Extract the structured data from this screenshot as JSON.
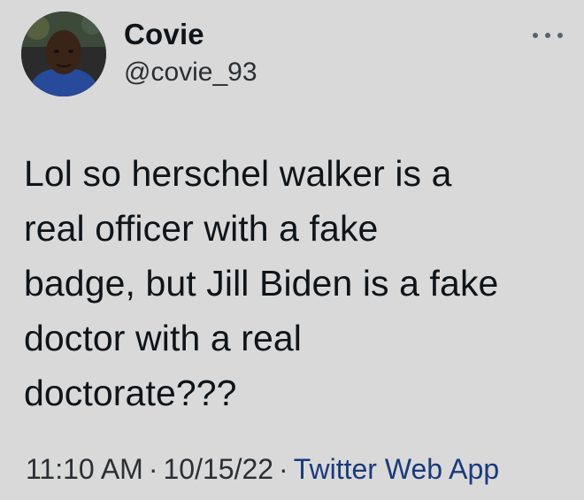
{
  "tweet": {
    "author": {
      "display_name": "Covie",
      "handle": "@covie_93",
      "avatar_icon": "profile-photo"
    },
    "menu_icon": "more-horizontal-icon",
    "text": "Lol so herschel walker is a\nreal officer with a fake\nbadge, but Jill Biden is a fake\ndoctor with a real\ndoctorate???",
    "time": "11:10 AM",
    "date": "10/15/22",
    "separator": "·",
    "source": "Twitter Web App"
  },
  "colors": {
    "background": "#d9d9d9",
    "text": "#0f1419",
    "muted": "#2b2f33",
    "link": "#1a3a7a"
  }
}
